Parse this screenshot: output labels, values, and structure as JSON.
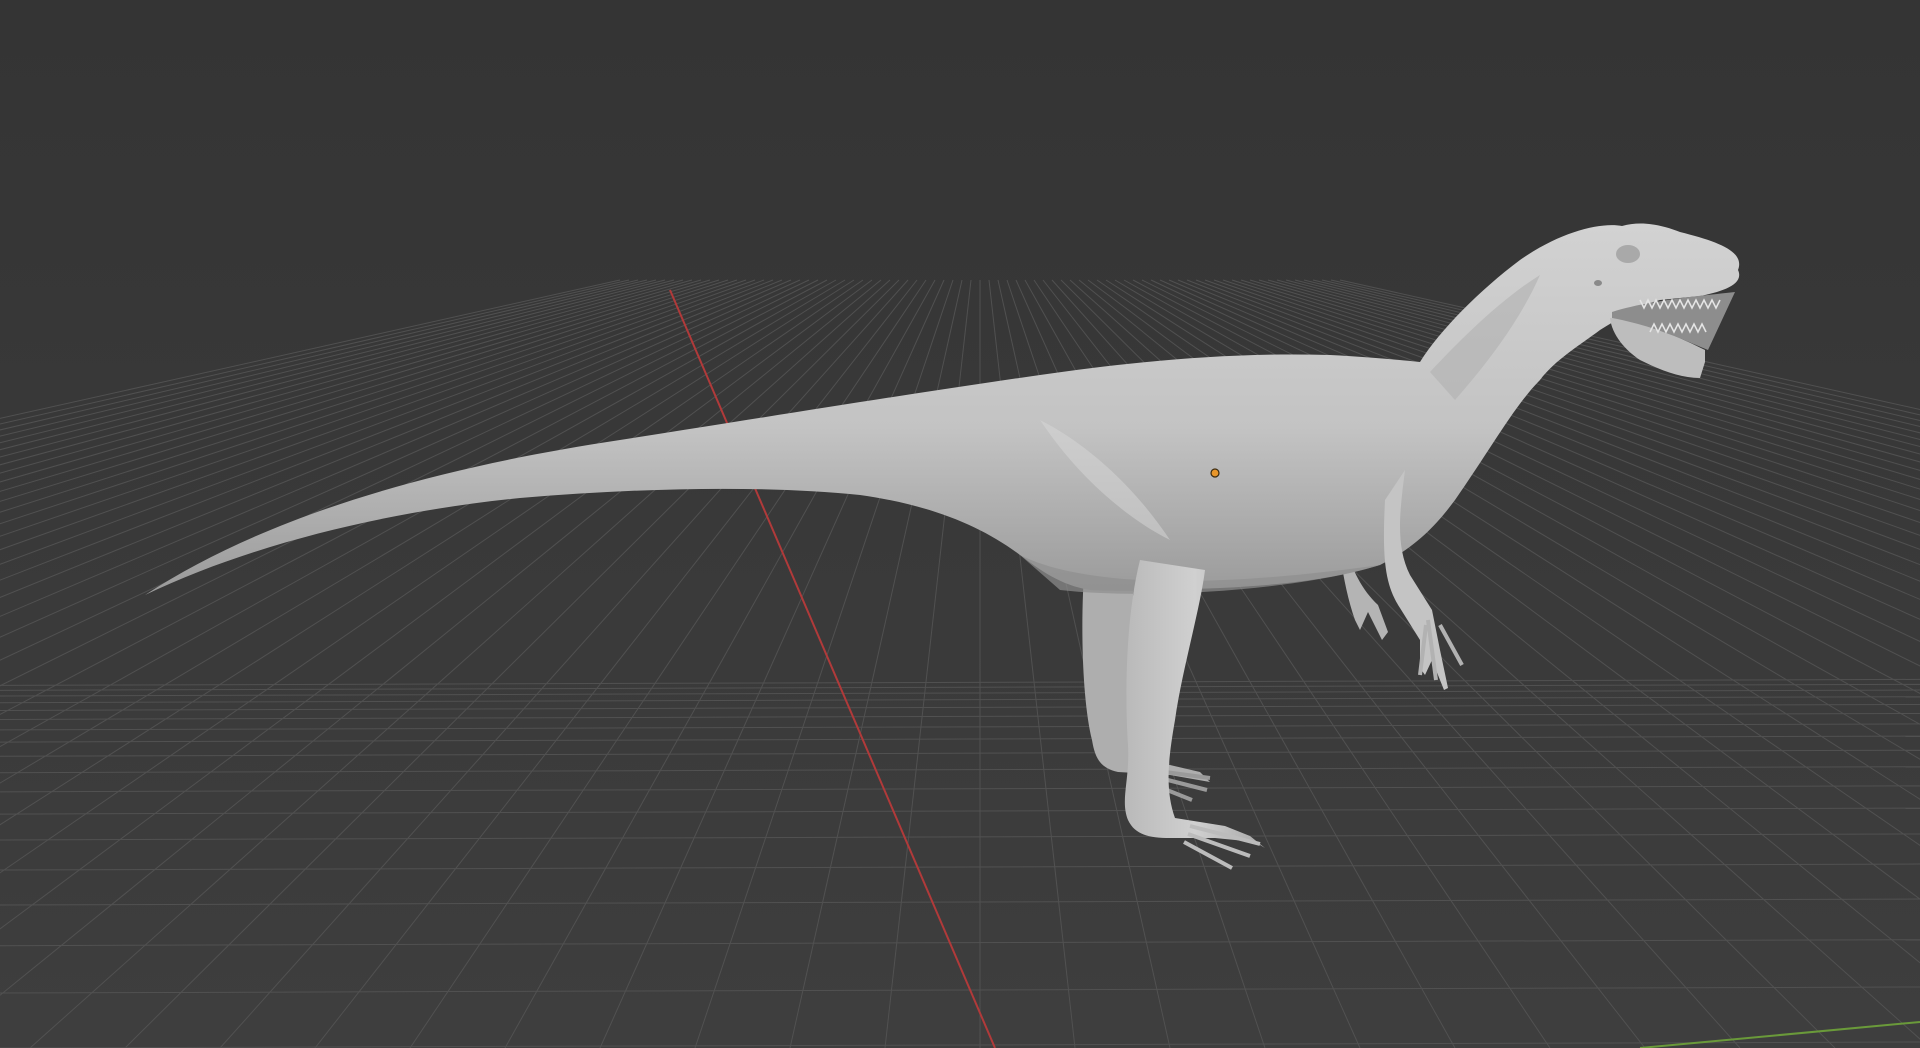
{
  "viewport": {
    "name": "3d-viewport",
    "background_top": "#353535",
    "background_bottom": "#3d3d3d",
    "grid_color": "#555555",
    "x_axis_color": "#b03a3a",
    "y_axis_color": "#6a9a3a",
    "origin_color": "#e8962a",
    "mesh_color": "#c9c9c9",
    "mesh_shadow": "#8f8f8f",
    "object": "dinosaur-sculpt-mesh"
  }
}
